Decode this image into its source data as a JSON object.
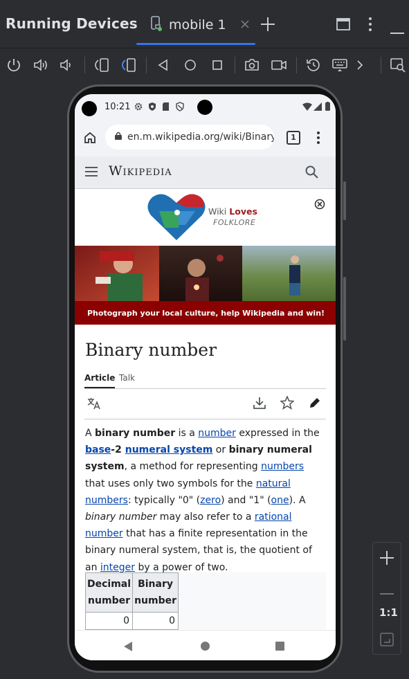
{
  "app": {
    "title": "Running Devices",
    "tab_label": "mobile 1",
    "accent": "#3574f0"
  },
  "toolbar_icons": [
    "power-icon",
    "volume-up-icon",
    "volume-down-icon",
    "rotate-left-icon",
    "rotate-right-icon",
    "back-icon",
    "home-icon",
    "overview-icon",
    "camera-icon",
    "screen-record-icon",
    "reset-icon",
    "keyboard-icon",
    "more-chevron-icon",
    "device-mirror-icon"
  ],
  "status": {
    "time": "10:21"
  },
  "browser": {
    "url": "en.m.wikipedia.org/wiki/Binary",
    "tab_count": "1"
  },
  "wiki": {
    "logo": "Wikipedia",
    "banner_wordmark_1": "Wiki",
    "banner_wordmark_2": "Loves",
    "banner_wordmark_3": "FOLKLORE",
    "banner_cta": "Photograph your local culture, help Wikipedia and win!",
    "page_title": "Binary number",
    "tab_article": "Article",
    "tab_talk": "Talk"
  },
  "paragraph": {
    "t1": "A ",
    "b1": "binary number",
    "t2": " is a ",
    "l1": "number",
    "t3": " expressed in the ",
    "l2": "base",
    "t4": "-2 ",
    "l3": "numeral system",
    "t5": " or ",
    "b2": "binary numeral system",
    "t6": ", a method for representing ",
    "l4": "numbers",
    "t7": " that uses only two symbols for the ",
    "l5": "natural numbers",
    "t8": ": typically \"0\" (",
    "l6": "zero",
    "t9": ") and \"1\" (",
    "l7": "one",
    "t10": "). A ",
    "i1": "binary number",
    "t11": " may also refer to a ",
    "l8": "rational number",
    "t12": " that has a finite representation in the binary numeral system, that is, the quotient of an ",
    "l9": "integer",
    "t13": " by a power of two."
  },
  "table": {
    "headers": [
      "Decimal number",
      "Binary number"
    ],
    "rows": [
      [
        "0",
        "0"
      ]
    ]
  },
  "zoom_panel": {
    "one_to_one": "1:1"
  }
}
